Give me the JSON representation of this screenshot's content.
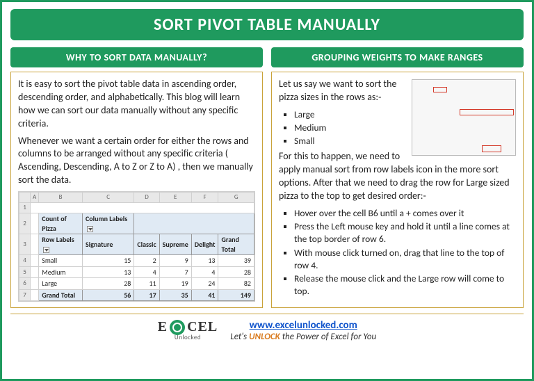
{
  "title": "SORT PIVOT TABLE MANUALLY",
  "left": {
    "heading": "WHY TO SORT DATA MANUALLY?",
    "para1": "It is easy to sort the pivot table data in ascending order, descending order, and alphabetically. This blog will learn how we can sort our data manually without any specific criteria.",
    "para2": "Whenever we want a certain order for either the rows and columns to be arranged without any specific criteria ( Ascending, Descending, A to Z or Z to A) , then we manually sort the data."
  },
  "right": {
    "heading": "GROUPING WEIGHTS TO MAKE RANGES",
    "intro": "Let us say we want to sort the pizza sizes in the rows as:-",
    "sizes": [
      "Large",
      "Medium",
      "Small"
    ],
    "mid": "For this to happen, we need to apply manual sort from row labels icon in the more sort options. After that we need to drag the row for Large sized pizza to the top to get desired order:-",
    "steps": [
      "Hover over the cell B6 until a + comes over it",
      "Press the Left mouse key and hold it until a line comes at the top border of row 6.",
      "With mouse click turned on, drag that line to the top of row 4.",
      "Release the mouse click and the Large row will come to top."
    ]
  },
  "pivot": {
    "colLetters": [
      "",
      "A",
      "B",
      "C",
      "D",
      "E",
      "F",
      "G"
    ],
    "label_count": "Count of Pizza",
    "label_collabels": "Column Labels",
    "label_rowlabels": "Row Labels",
    "cols": [
      "Signature",
      "Classic",
      "Supreme",
      "Delight",
      "Grand Total"
    ],
    "rows": [
      {
        "n": "4",
        "label": "Small",
        "v": [
          "15",
          "2",
          "9",
          "13",
          "39"
        ]
      },
      {
        "n": "5",
        "label": "Medium",
        "v": [
          "13",
          "4",
          "7",
          "4",
          "28"
        ]
      },
      {
        "n": "6",
        "label": "Large",
        "v": [
          "28",
          "11",
          "19",
          "24",
          "82"
        ]
      }
    ],
    "grand": {
      "n": "7",
      "label": "Grand Total",
      "v": [
        "56",
        "17",
        "35",
        "41",
        "149"
      ]
    }
  },
  "footer": {
    "logo1": "E",
    "logo2": "CEL",
    "logosub": "Unlocked",
    "url": "www.excelunlocked.com",
    "tag1": "Let's ",
    "tag2": "UNLOCK",
    "tag3": " the Power of Excel for You"
  }
}
